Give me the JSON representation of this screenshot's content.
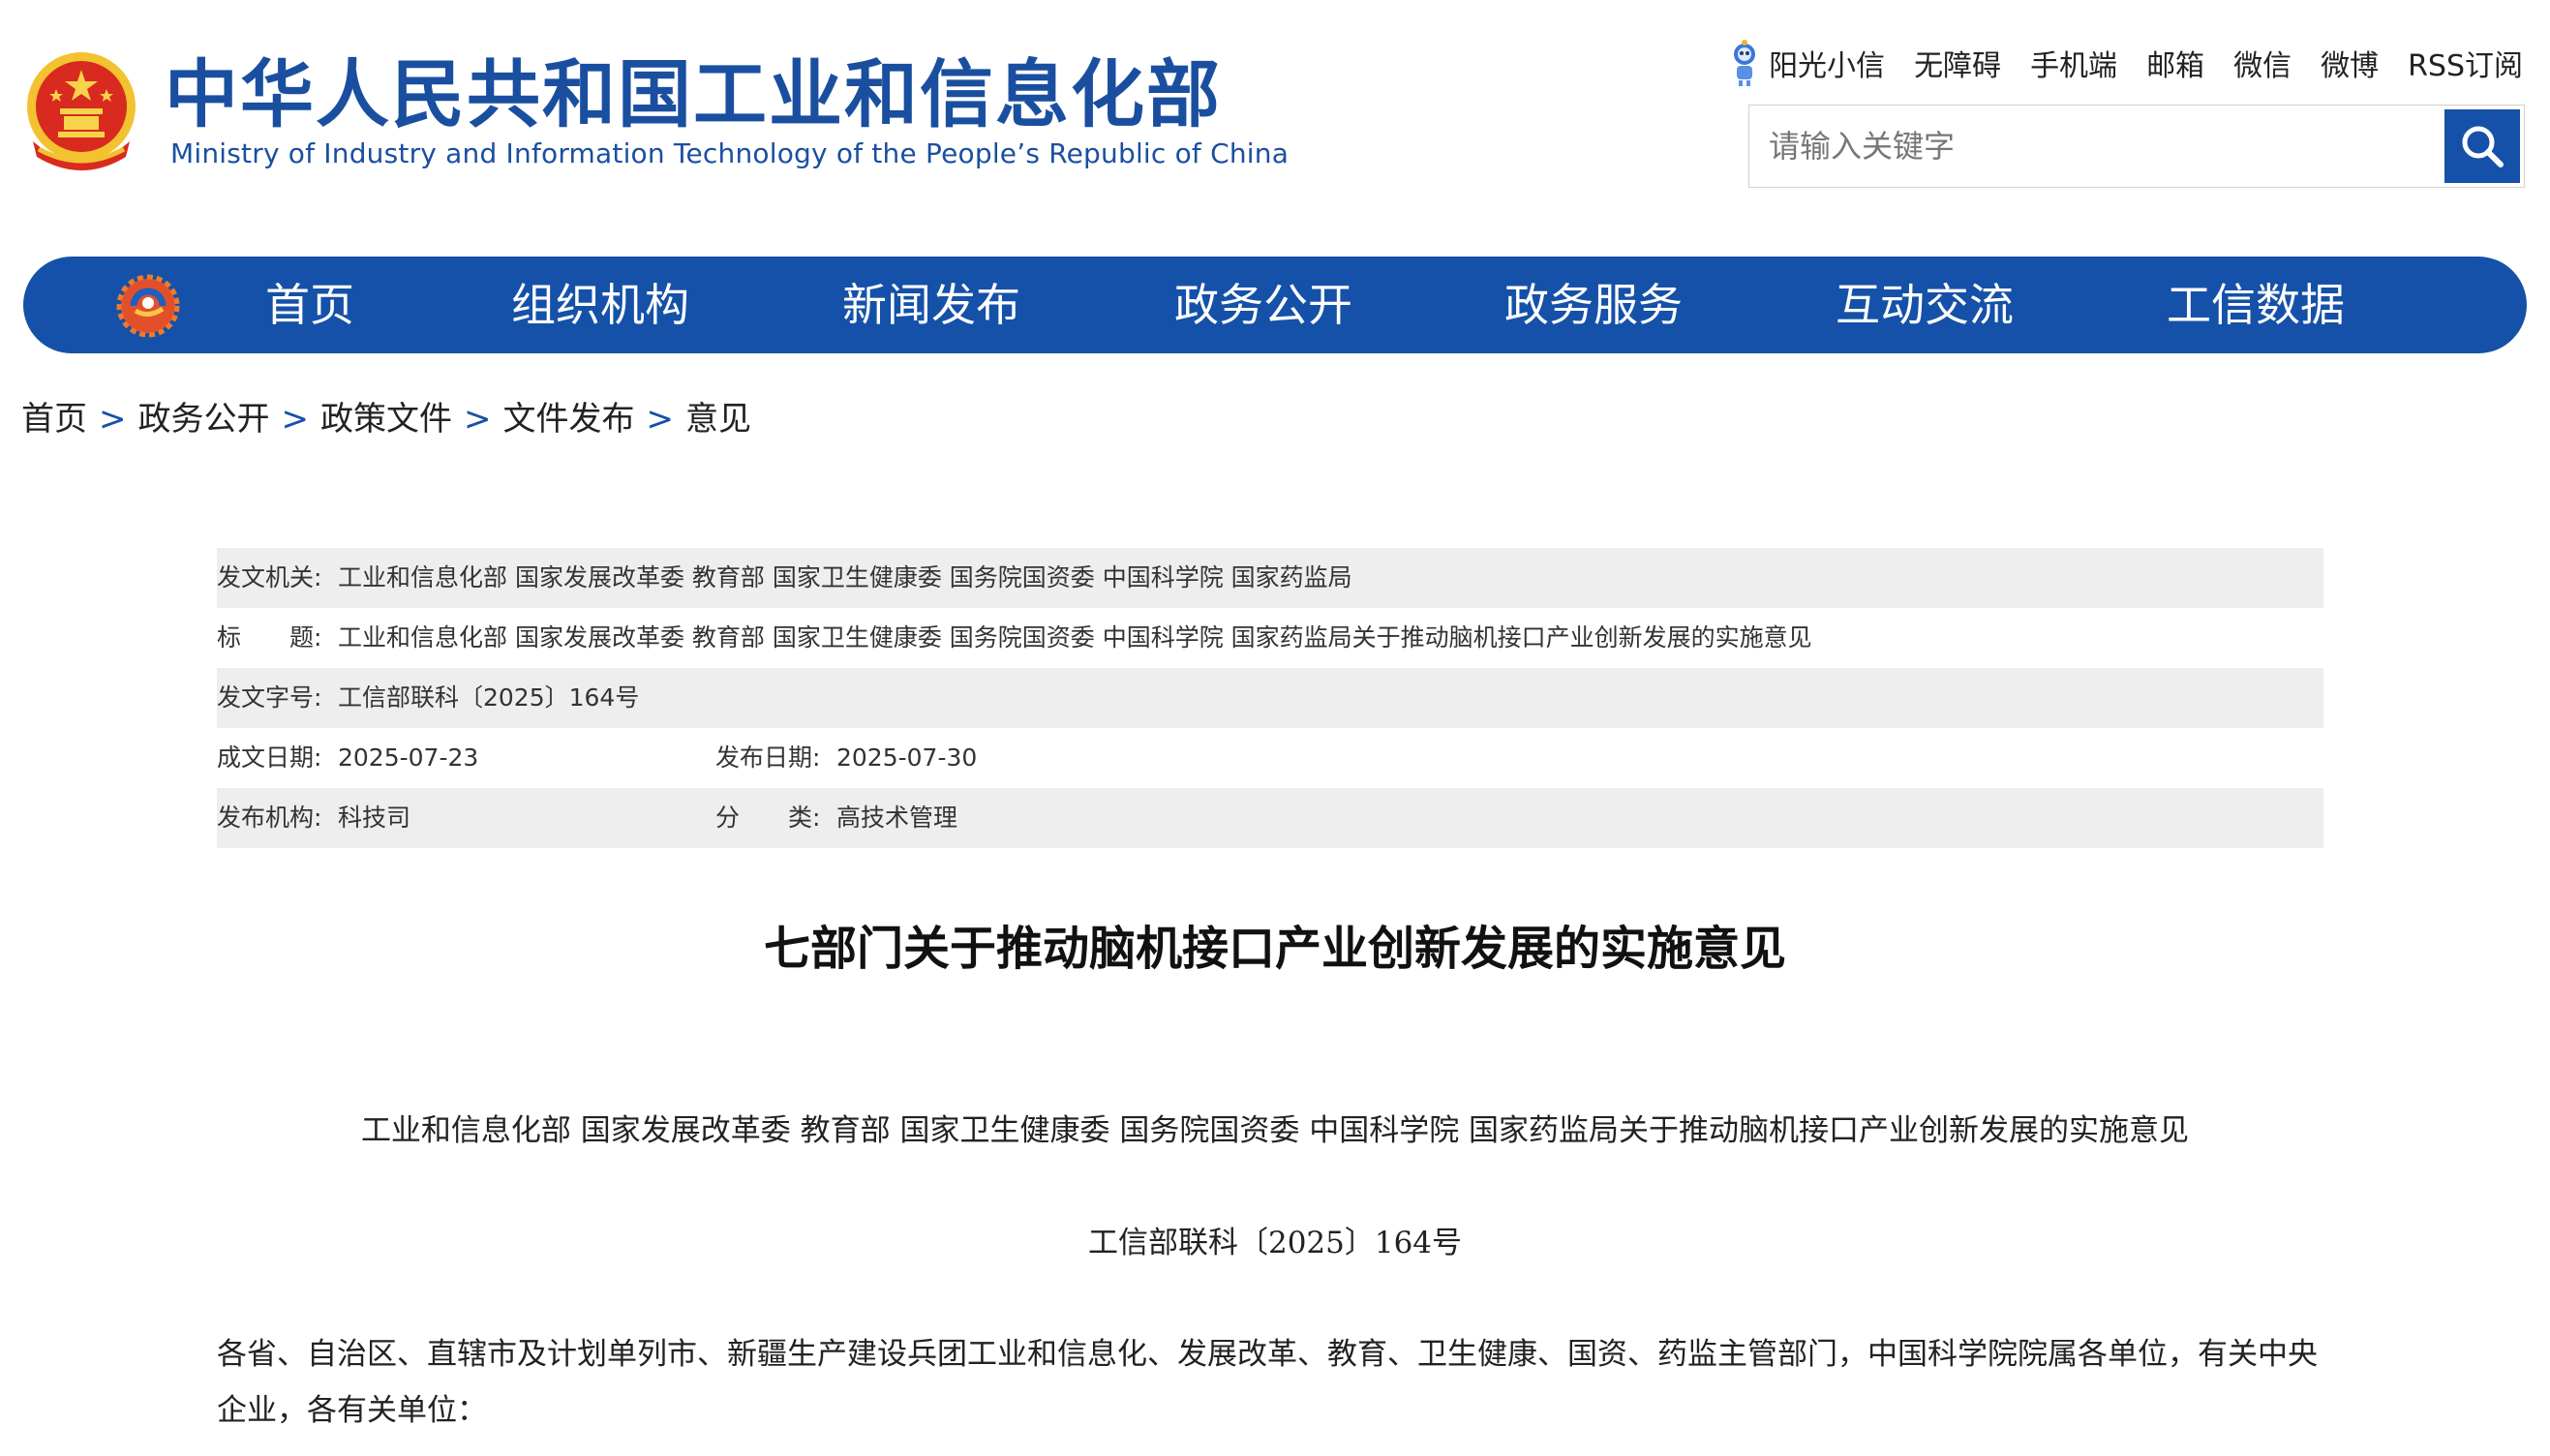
{
  "header": {
    "logo_cn": "中华人民共和国工业和信息化部",
    "logo_en": "Ministry of Industry and Information Technology of the People’s Republic of China",
    "top_links": [
      "阳光小信",
      "无障碍",
      "手机端",
      "邮箱",
      "微信",
      "微博",
      "RSS订阅"
    ],
    "search_placeholder": "请输入关键字"
  },
  "nav": {
    "items": [
      "首页",
      "组织机构",
      "新闻发布",
      "政务公开",
      "政务服务",
      "互动交流",
      "工信数据"
    ]
  },
  "breadcrumb": [
    "首页",
    "政务公开",
    "政策文件",
    "文件发布",
    "意见"
  ],
  "breadcrumb_sep": ">",
  "meta": {
    "issuer_label": "发文机关:",
    "issuer": "工业和信息化部 国家发展改革委 教育部 国家卫生健康委 国务院国资委 中国科学院 国家药监局",
    "title_label": "标　　题:",
    "title": "工业和信息化部 国家发展改革委 教育部 国家卫生健康委 国务院国资委 中国科学院 国家药监局关于推动脑机接口产业创新发展的实施意见",
    "docno_label": "发文字号:",
    "docno": "工信部联科〔2025〕164号",
    "written_label": "成文日期:",
    "written": "2025-07-23",
    "published_label": "发布日期:",
    "published": "2025-07-30",
    "org_label": "发布机构:",
    "org": "科技司",
    "category_label": "分　　类:",
    "category": "高技术管理"
  },
  "article": {
    "title": "七部门关于推动脑机接口产业创新发展的实施意见",
    "subtitle": "工业和信息化部  国家发展改革委  教育部  国家卫生健康委  国务院国资委  中国科学院  国家药监局关于推动脑机接口产业创新发展的实施意见",
    "docno": "工信部联科〔2025〕164号",
    "paragraph": "各省、自治区、直辖市及计划单列市、新疆生产建设兵团工业和信息化、发展改革、教育、卫生健康、国资、药监主管部门，中国科学院院属各单位，有关中央企业，各有关单位："
  },
  "colors": {
    "brand_blue": "#1551a8",
    "meta_shade": "#eeeeee"
  }
}
